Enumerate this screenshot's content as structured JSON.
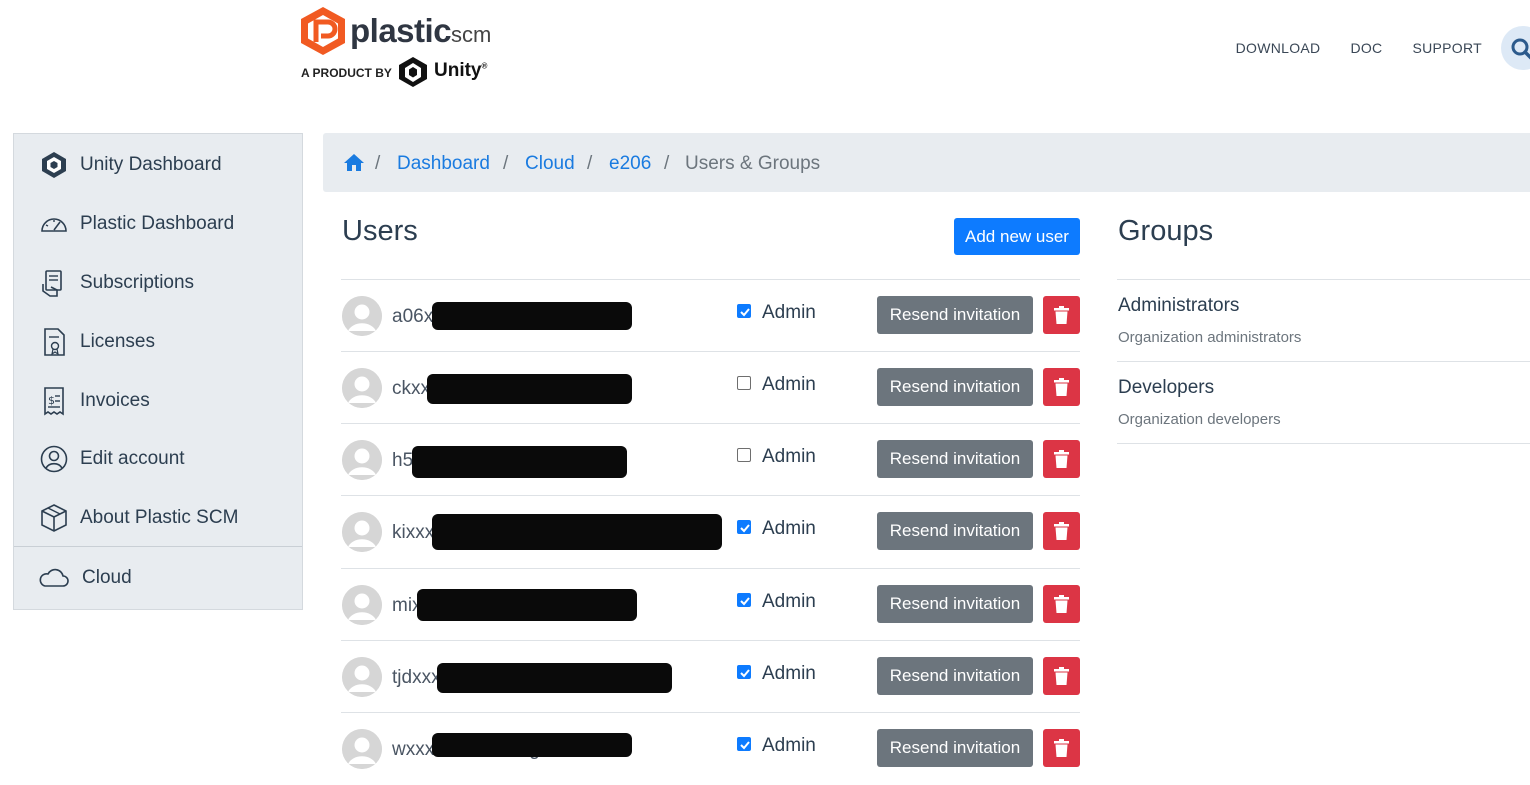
{
  "header": {
    "brand_word": "plastic",
    "brand_suffix": "scm",
    "product_by": "A PRODUCT BY",
    "unity_word": "Unity",
    "nav": [
      "DOWNLOAD",
      "DOC",
      "SUPPORT"
    ]
  },
  "sidebar": {
    "items": [
      {
        "label": "Unity Dashboard",
        "icon": "unity-cube-icon"
      },
      {
        "label": "Plastic Dashboard",
        "icon": "speedometer-icon"
      },
      {
        "label": "Subscriptions",
        "icon": "hand-card-icon"
      },
      {
        "label": "Licenses",
        "icon": "license-certificate-icon"
      },
      {
        "label": "Invoices",
        "icon": "invoice-icon"
      },
      {
        "label": "Edit account",
        "icon": "user-circle-icon"
      },
      {
        "label": "About Plastic SCM",
        "icon": "box-icon"
      }
    ],
    "footer_item": {
      "label": "Cloud",
      "icon": "cloud-icon"
    }
  },
  "breadcrumb": {
    "items": [
      "Dashboard",
      "Cloud",
      "e206"
    ],
    "current": "Users & Groups",
    "separator": "/"
  },
  "users": {
    "title": "Users",
    "add_button": "Add new user",
    "admin_label": "Admin",
    "resend_label": "Resend invitation",
    "rows": [
      {
        "email": "a06xxxxxxxxxxxil.com",
        "admin": true
      },
      {
        "email": "ckxxxxxxxxxxgmail.com",
        "admin": false
      },
      {
        "email": "h52xxxxxxxxxxil.com",
        "admin": false
      },
      {
        "email": "kixxxxxxxxxxxxxxxxail.com",
        "admin": true
      },
      {
        "email": "mixxxxxxxxxxxxnavercom",
        "admin": true
      },
      {
        "email": "tjdxxxxxxxx@gmail.com",
        "admin": true
      },
      {
        "email": "wxxxxxxxxxxxxxgmail.com",
        "admin": true
      }
    ]
  },
  "groups": {
    "title": "Groups",
    "items": [
      {
        "name": "Administrators",
        "desc": "Organization administrators"
      },
      {
        "name": "Developers",
        "desc": "Organization developers"
      }
    ]
  },
  "colors": {
    "primary": "#0d7bff",
    "secondary": "#6c757d",
    "danger": "#dc3545",
    "sidebar_bg": "#e8ecf0",
    "brand_orange": "#f15a22"
  }
}
